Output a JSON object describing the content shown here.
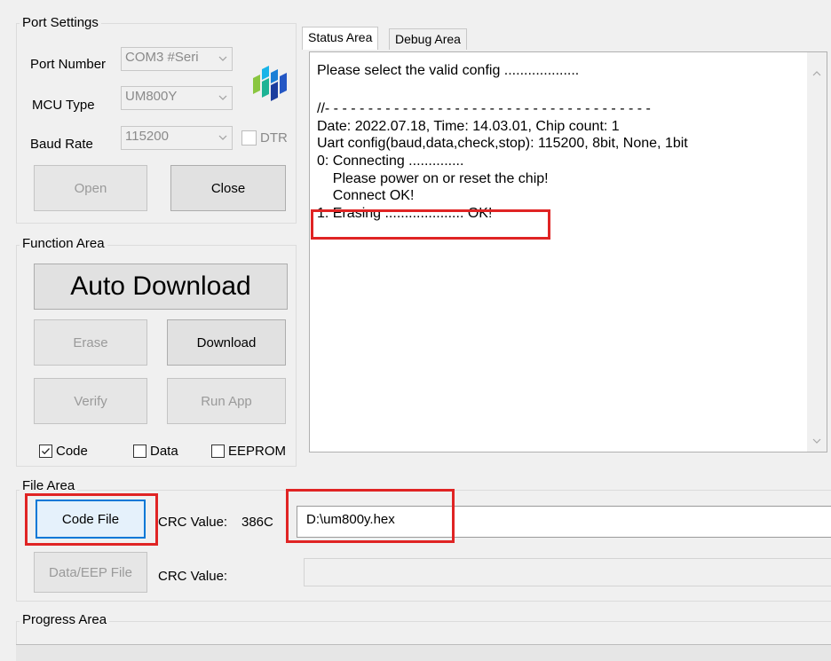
{
  "port_settings": {
    "title": "Port Settings",
    "port_number_label": "Port Number",
    "port_number_value": "COM3 #Seri",
    "mcu_type_label": "MCU Type",
    "mcu_type_value": "UM800Y",
    "baud_rate_label": "Baud Rate",
    "baud_rate_value": "115200",
    "dtr_label": "DTR",
    "open_label": "Open",
    "close_label": "Close"
  },
  "function_area": {
    "title": "Function Area",
    "auto_download_label": "Auto Download",
    "erase_label": "Erase",
    "download_label": "Download",
    "verify_label": "Verify",
    "run_app_label": "Run App",
    "code_check_label": "Code",
    "data_check_label": "Data",
    "eeprom_check_label": "EEPROM"
  },
  "tabs": {
    "status_label": "Status Area",
    "debug_label": "Debug Area"
  },
  "status_log": {
    "lines": [
      "Please select the valid config ...................",
      "//- - - - - - - - - - - - - - - - - - - - - - - - - - - - - - - - - - - - - -",
      "Date: 2022.07.18, Time: 14.03.01, Chip count: 1",
      "Uart config(baud,data,check,stop): 115200, 8bit, None, 1bit",
      "0: Connecting ..............",
      "    Please power on or reset the chip!",
      "    Connect OK!",
      "1: Erasing .................... OK!"
    ]
  },
  "file_area": {
    "title": "File Area",
    "code_file_label": "Code File",
    "crc_label_1": "CRC Value:",
    "crc_value_1": "386C",
    "code_path": "D:\\um800y.hex",
    "data_eep_label": "Data/EEP File",
    "crc_label_2": "CRC Value:",
    "data_path": ""
  },
  "progress_area": {
    "title": "Progress Area"
  },
  "colors": {
    "highlight": "#e02424",
    "focus_border": "#0078d7"
  }
}
